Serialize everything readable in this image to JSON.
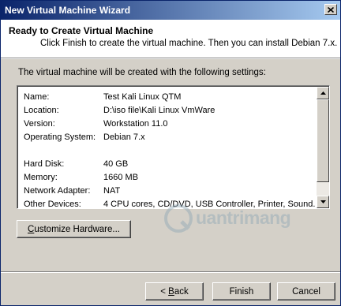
{
  "window": {
    "title": "New Virtual Machine Wizard"
  },
  "header": {
    "title": "Ready to Create Virtual Machine",
    "subtitle": "Click Finish to create the virtual machine. Then you can install Debian 7.x."
  },
  "intro": "The virtual machine will be created with the following settings:",
  "settings": [
    {
      "label": "Name:",
      "value": "Test Kali Linux QTM"
    },
    {
      "label": "Location:",
      "value": "D:\\iso file\\Kali Linux VmWare"
    },
    {
      "label": "Version:",
      "value": "Workstation 11.0"
    },
    {
      "label": "Operating System:",
      "value": "Debian 7.x"
    },
    {
      "label": "",
      "value": ""
    },
    {
      "label": "Hard Disk:",
      "value": "40 GB"
    },
    {
      "label": "Memory:",
      "value": "1660 MB"
    },
    {
      "label": "Network Adapter:",
      "value": "NAT"
    },
    {
      "label": "Other Devices:",
      "value": "4 CPU cores, CD/DVD, USB Controller, Printer, Sound..."
    }
  ],
  "buttons": {
    "customize_pre": "",
    "customize_key": "C",
    "customize_post": "ustomize Hardware...",
    "back_pre": "< ",
    "back_key": "B",
    "back_post": "ack",
    "finish": "Finish",
    "cancel": "Cancel"
  },
  "watermark": {
    "text": "uantrimang"
  },
  "icons": {
    "close": "close-icon",
    "scroll_up": "triangle-up-icon",
    "scroll_down": "triangle-down-icon"
  },
  "colors": {
    "titlebar_start": "#0a246a",
    "titlebar_end": "#a6caf0",
    "dialog_bg": "#d4d0c8"
  }
}
